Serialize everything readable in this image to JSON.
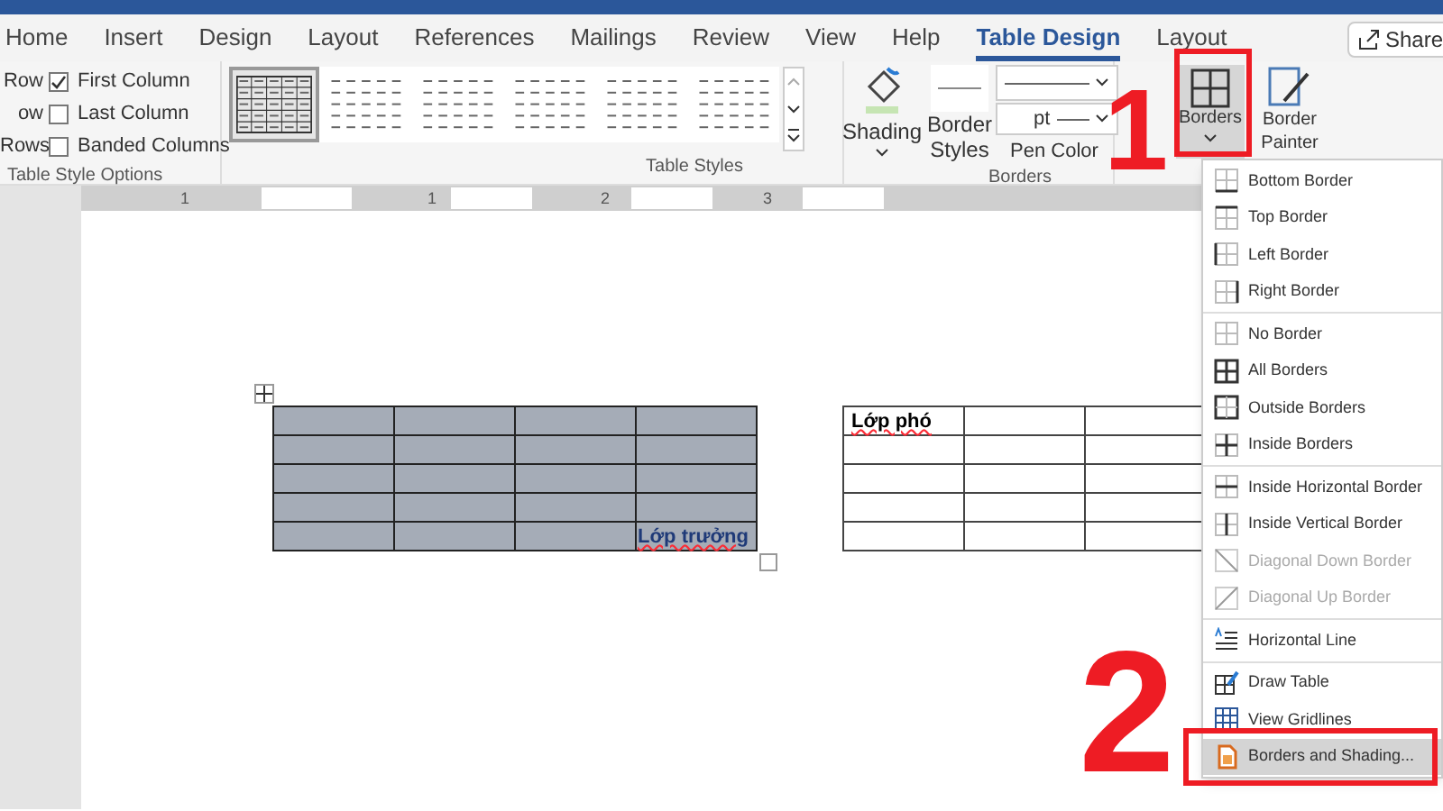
{
  "tabs": [
    {
      "label": "Home",
      "selected": false
    },
    {
      "label": "Insert",
      "selected": false
    },
    {
      "label": "Design",
      "selected": false
    },
    {
      "label": "Layout",
      "selected": false
    },
    {
      "label": "References",
      "selected": false
    },
    {
      "label": "Mailings",
      "selected": false
    },
    {
      "label": "Review",
      "selected": false
    },
    {
      "label": "View",
      "selected": false
    },
    {
      "label": "Help",
      "selected": false
    },
    {
      "label": "Table Design",
      "selected": true
    },
    {
      "label": "Layout",
      "selected": false
    }
  ],
  "share": {
    "label": "Share"
  },
  "table_style_options": {
    "left_labels": [
      "Row",
      "ow",
      "Rows"
    ],
    "checkboxes": [
      {
        "label": "First Column",
        "checked": true
      },
      {
        "label": "Last Column",
        "checked": false
      },
      {
        "label": "Banded Columns",
        "checked": false
      }
    ],
    "group_label": "Table Style Options"
  },
  "table_styles": {
    "styles": [
      {
        "selected": true
      },
      {
        "selected": false
      },
      {
        "selected": false
      },
      {
        "selected": false
      },
      {
        "selected": false
      },
      {
        "selected": false
      }
    ],
    "group_label": "Table Styles"
  },
  "shading": {
    "label": "Shading"
  },
  "borders_group": {
    "border_styles": "Border Styles",
    "weight": "pt",
    "pen_color": "Pen Color",
    "borders": "Borders",
    "border_painter": "Border Painter",
    "group_label": "Borders"
  },
  "ruler": {
    "labels": [
      "1",
      "1",
      "2",
      "3"
    ]
  },
  "tables": [
    {
      "selected": true,
      "rows": [
        {
          "cells": [
            {},
            {},
            {},
            {}
          ]
        },
        {
          "cells": [
            {},
            {},
            {},
            {}
          ]
        },
        {
          "cells": [
            {},
            {},
            {},
            {}
          ]
        },
        {
          "cells": [
            {},
            {},
            {},
            {}
          ]
        },
        {
          "cells": [
            {},
            {},
            {},
            {
              "text": "Lớp trưởng"
            }
          ]
        }
      ]
    },
    {
      "selected": false,
      "rows": [
        {
          "cells": [
            {
              "text": "Lớp phó"
            },
            {},
            {}
          ]
        },
        {
          "cells": [
            {},
            {},
            {}
          ]
        },
        {
          "cells": [
            {},
            {},
            {}
          ]
        },
        {
          "cells": [
            {},
            {},
            {}
          ]
        },
        {
          "cells": [
            {},
            {},
            {}
          ]
        }
      ]
    }
  ],
  "borders_menu": {
    "sections": [
      [
        {
          "label": "Bottom Border",
          "disabled": false,
          "selected": false
        },
        {
          "label": "Top Border",
          "disabled": false,
          "selected": false
        },
        {
          "label": "Left Border",
          "disabled": false,
          "selected": false
        },
        {
          "label": "Right Border",
          "disabled": false,
          "selected": false
        }
      ],
      [
        {
          "label": "No Border",
          "disabled": false,
          "selected": false
        },
        {
          "label": "All Borders",
          "disabled": false,
          "selected": false
        },
        {
          "label": "Outside Borders",
          "disabled": false,
          "selected": false
        },
        {
          "label": "Inside Borders",
          "disabled": false,
          "selected": false
        }
      ],
      [
        {
          "label": "Inside Horizontal Border",
          "disabled": false,
          "selected": false
        },
        {
          "label": "Inside Vertical Border",
          "disabled": false,
          "selected": false
        },
        {
          "label": "Diagonal Down Border",
          "disabled": true,
          "selected": false
        },
        {
          "label": "Diagonal Up Border",
          "disabled": true,
          "selected": false
        }
      ],
      [
        {
          "label": "Horizontal Line",
          "disabled": false,
          "selected": false
        }
      ],
      [
        {
          "label": "Draw Table",
          "disabled": false,
          "selected": false
        },
        {
          "label": "View Gridlines",
          "disabled": false,
          "selected": false
        },
        {
          "label": "Borders and Shading...",
          "disabled": false,
          "selected": true
        }
      ]
    ]
  },
  "annotations": [
    {
      "label": "1"
    },
    {
      "label": "2"
    }
  ]
}
